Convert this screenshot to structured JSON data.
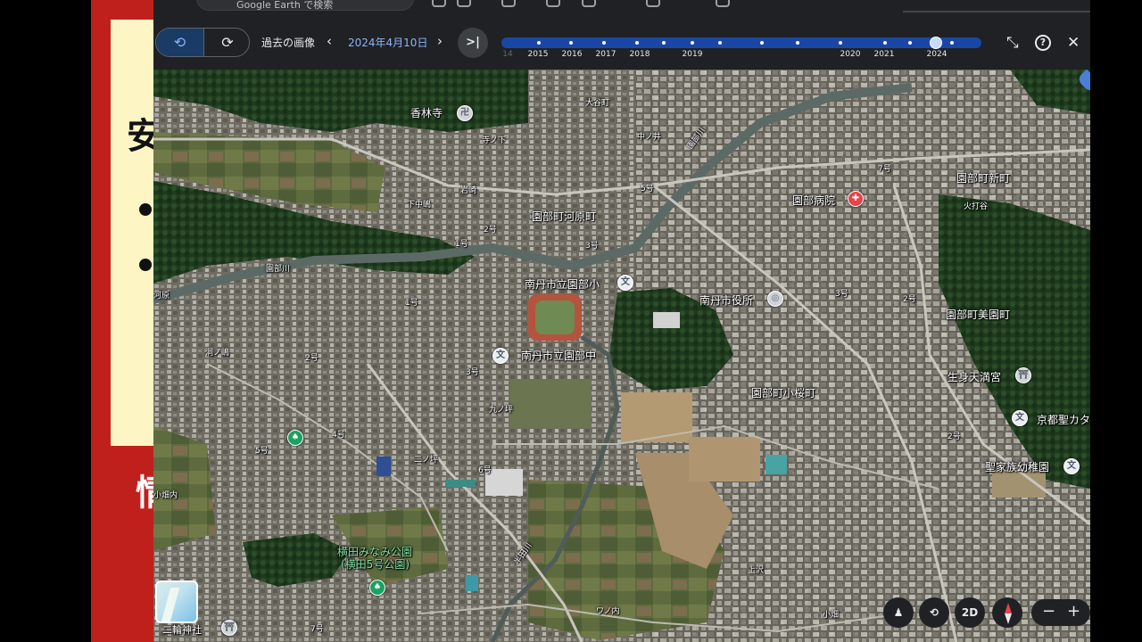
{
  "slide": {
    "glyph_top": "安",
    "glyph_bottom": "情"
  },
  "topbar": {
    "search_text": "Google Earth で検索"
  },
  "history": {
    "label": "過去の画像",
    "date": "2024年4月10日",
    "prev_icon": "chevron-left",
    "next_icon": "chevron-right",
    "jump_latest_icon": "skip-to-latest",
    "timeline_years": [
      "14",
      "2015",
      "2016",
      "2017",
      "2018",
      "2019",
      "2020",
      "2021",
      "2024"
    ],
    "selected_year": "2024",
    "accent": "#1a47a6"
  },
  "map_labels": {
    "koujinji": "香林寺",
    "oaza": "大谷町",
    "teranoshita": "寺ノ下",
    "nakanoi": "中ノ井",
    "iwasaki": "岩崎",
    "shimonakaza": "下中嶋",
    "kawarachou": "園部町河原町",
    "sonobe_river1": "園部川",
    "sonobe_river2": "園部川",
    "go5": "5号",
    "ichigo1": "1号",
    "nigo1": "2号",
    "sangou1": "3号",
    "nanatan_sho": "南丹市立園部小",
    "nanatan_yakusho": "南丹市役所",
    "sonobe_byouin": "園部病院",
    "go7": "7号",
    "shinmachi": "園部町新町",
    "hiuchidani": "火打谷",
    "mibanchou": "園部町美園町",
    "ikumi": "生身天満宮",
    "kyoto_sei": "京都聖カタ",
    "seika": "聖家族幼稚園",
    "kozakura": "園部町小桜町",
    "nanatan_chu": "南丹市立園部中",
    "kyunoi": "九ノ坪",
    "nishinotsubo": "二ノ坪",
    "rokugou": "6号",
    "yongou": "4号",
    "gogou2": "5号",
    "nigou2": "2号",
    "sangou2": "3号",
    "ichigo2": "1号",
    "ichigou3": "1号",
    "nigou3": "2号",
    "sangou3": "3号",
    "nigou4": "2号",
    "dozuno": "洞ノ嶋",
    "kawara": "河原",
    "koujiuchi": "小畑内",
    "yokota_park": "横田みなみ公園",
    "yokota_park2": "(横田5号公園)",
    "handa_river": "半田川",
    "kamisawa": "上沢",
    "wanouchi": "ワノ内",
    "futatsuwa": "二輪神社",
    "nanagou2": "7号",
    "kobata": "小畑"
  },
  "controls": {
    "view_2d": "2D",
    "zoom_out": "−",
    "zoom_in": "+",
    "pegman_icon": "pegman-icon",
    "tilt_icon": "tilt-icon",
    "compass_icon": "compass-icon"
  }
}
